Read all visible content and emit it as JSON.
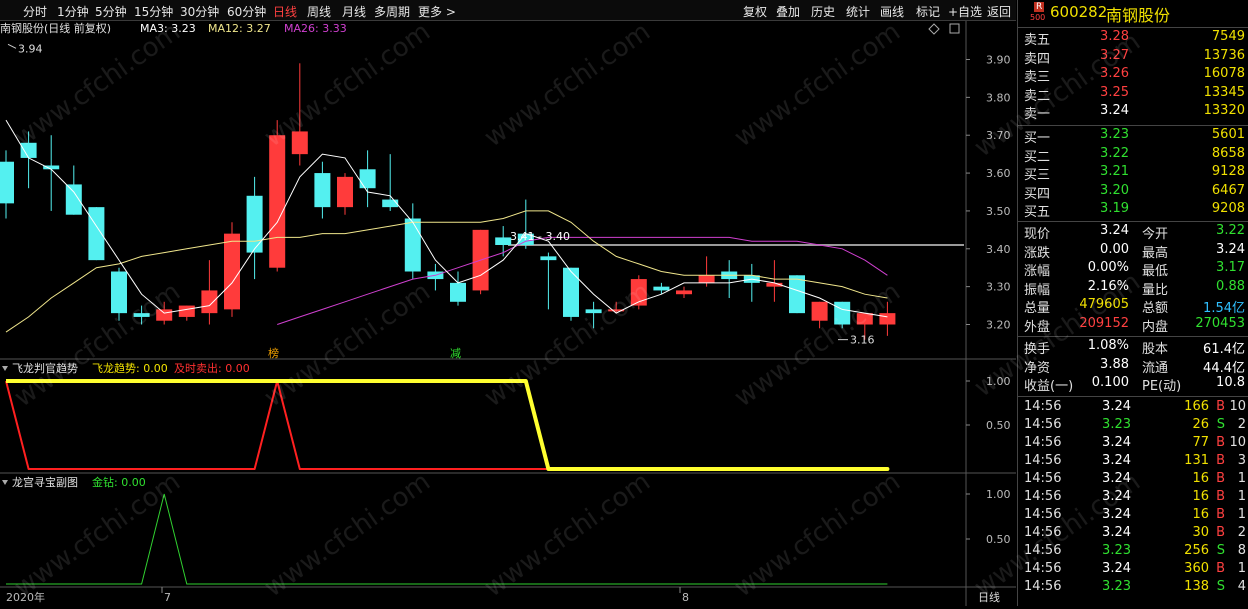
{
  "toolbar": {
    "left_items": [
      "分时",
      "1分钟",
      "5分钟",
      "15分钟",
      "30分钟",
      "60分钟",
      "日线",
      "周线",
      "月线",
      "多周期",
      "更多 >"
    ],
    "active": "日线",
    "right_items": [
      "复权",
      "叠加",
      "历史",
      "统计",
      "画线",
      "标记",
      "+自选",
      "返回"
    ]
  },
  "main_chart": {
    "title": "南钢股份(日线 前复权)",
    "ma3_label": "MA3: 3.23",
    "ma12_label": "MA12: 3.27",
    "ma26_label": "MA26: 3.33",
    "max_label": "3.94",
    "min_label": "3.16",
    "range_label": "3.41 - 3.40",
    "mark_a": "榜",
    "mark_b": "减",
    "y_ticks": [
      "3.90",
      "3.80",
      "3.70",
      "3.60",
      "3.50",
      "3.40",
      "3.30",
      "3.20"
    ],
    "colors": {
      "up": "#ff3b3b",
      "down": "#54f0f0",
      "ma3": "#ffffff",
      "ma12": "#f0e68c",
      "ma26": "#d040d0"
    }
  },
  "chart_data": {
    "type": "candlestick",
    "ylim": [
      3.13,
      3.97
    ],
    "candles": [
      {
        "o": 3.63,
        "h": 3.66,
        "l": 3.48,
        "c": 3.52
      },
      {
        "o": 3.68,
        "h": 3.71,
        "l": 3.56,
        "c": 3.64
      },
      {
        "o": 3.62,
        "h": 3.7,
        "l": 3.5,
        "c": 3.61
      },
      {
        "o": 3.57,
        "h": 3.62,
        "l": 3.49,
        "c": 3.49
      },
      {
        "o": 3.51,
        "h": 3.51,
        "l": 3.37,
        "c": 3.37
      },
      {
        "o": 3.34,
        "h": 3.35,
        "l": 3.21,
        "c": 3.23
      },
      {
        "o": 3.23,
        "h": 3.25,
        "l": 3.2,
        "c": 3.22
      },
      {
        "o": 3.21,
        "h": 3.26,
        "l": 3.2,
        "c": 3.24
      },
      {
        "o": 3.22,
        "h": 3.25,
        "l": 3.21,
        "c": 3.25
      },
      {
        "o": 3.23,
        "h": 3.37,
        "l": 3.2,
        "c": 3.29
      },
      {
        "o": 3.24,
        "h": 3.47,
        "l": 3.22,
        "c": 3.44
      },
      {
        "o": 3.54,
        "h": 3.59,
        "l": 3.32,
        "c": 3.39
      },
      {
        "o": 3.35,
        "h": 3.74,
        "l": 3.34,
        "c": 3.7
      },
      {
        "o": 3.65,
        "h": 3.89,
        "l": 3.62,
        "c": 3.71
      },
      {
        "o": 3.6,
        "h": 3.63,
        "l": 3.48,
        "c": 3.51
      },
      {
        "o": 3.51,
        "h": 3.6,
        "l": 3.49,
        "c": 3.59
      },
      {
        "o": 3.61,
        "h": 3.66,
        "l": 3.51,
        "c": 3.56
      },
      {
        "o": 3.53,
        "h": 3.65,
        "l": 3.5,
        "c": 3.51
      },
      {
        "o": 3.48,
        "h": 3.52,
        "l": 3.32,
        "c": 3.34
      },
      {
        "o": 3.34,
        "h": 3.36,
        "l": 3.29,
        "c": 3.32
      },
      {
        "o": 3.31,
        "h": 3.34,
        "l": 3.25,
        "c": 3.26
      },
      {
        "o": 3.29,
        "h": 3.45,
        "l": 3.28,
        "c": 3.45
      },
      {
        "o": 3.43,
        "h": 3.46,
        "l": 3.38,
        "c": 3.41
      },
      {
        "o": 3.44,
        "h": 3.53,
        "l": 3.4,
        "c": 3.41
      },
      {
        "o": 3.38,
        "h": 3.39,
        "l": 3.24,
        "c": 3.37
      },
      {
        "o": 3.35,
        "h": 3.35,
        "l": 3.21,
        "c": 3.22
      },
      {
        "o": 3.24,
        "h": 3.26,
        "l": 3.19,
        "c": 3.23
      },
      {
        "o": 3.24,
        "h": 3.26,
        "l": 3.23,
        "c": 3.24
      },
      {
        "o": 3.25,
        "h": 3.33,
        "l": 3.24,
        "c": 3.32
      },
      {
        "o": 3.3,
        "h": 3.31,
        "l": 3.28,
        "c": 3.29
      },
      {
        "o": 3.28,
        "h": 3.3,
        "l": 3.27,
        "c": 3.29
      },
      {
        "o": 3.31,
        "h": 3.38,
        "l": 3.3,
        "c": 3.33
      },
      {
        "o": 3.34,
        "h": 3.37,
        "l": 3.27,
        "c": 3.32
      },
      {
        "o": 3.33,
        "h": 3.36,
        "l": 3.26,
        "c": 3.31
      },
      {
        "o": 3.3,
        "h": 3.37,
        "l": 3.26,
        "c": 3.31
      },
      {
        "o": 3.33,
        "h": 3.33,
        "l": 3.23,
        "c": 3.23
      },
      {
        "o": 3.21,
        "h": 3.26,
        "l": 3.19,
        "c": 3.26
      },
      {
        "o": 3.26,
        "h": 3.26,
        "l": 3.19,
        "c": 3.2
      },
      {
        "o": 3.2,
        "h": 3.23,
        "l": 3.16,
        "c": 3.23
      },
      {
        "o": 3.2,
        "h": 3.26,
        "l": 3.17,
        "c": 3.23
      }
    ],
    "ma3": [
      3.74,
      3.64,
      3.61,
      3.55,
      3.46,
      3.37,
      3.28,
      3.23,
      3.24,
      3.25,
      3.31,
      3.4,
      3.47,
      3.59,
      3.65,
      3.64,
      3.55,
      3.54,
      3.47,
      3.37,
      3.31,
      3.33,
      3.37,
      3.44,
      3.42,
      3.34,
      3.28,
      3.23,
      3.26,
      3.28,
      3.31,
      3.31,
      3.31,
      3.32,
      3.31,
      3.29,
      3.27,
      3.24,
      3.23,
      3.22
    ],
    "ma12": [
      3.18,
      3.22,
      3.27,
      3.31,
      3.35,
      3.36,
      3.38,
      3.39,
      3.4,
      3.41,
      3.42,
      3.42,
      3.43,
      3.43,
      3.44,
      3.44,
      3.45,
      3.46,
      3.47,
      3.47,
      3.47,
      3.47,
      3.48,
      3.5,
      3.5,
      3.47,
      3.42,
      3.38,
      3.36,
      3.34,
      3.33,
      3.33,
      3.33,
      3.33,
      3.32,
      3.32,
      3.31,
      3.3,
      3.28,
      3.27
    ],
    "ma26": [
      null,
      null,
      null,
      null,
      null,
      null,
      null,
      null,
      null,
      null,
      null,
      null,
      3.2,
      3.22,
      3.24,
      3.26,
      3.28,
      3.3,
      3.32,
      3.33,
      3.35,
      3.37,
      3.39,
      3.42,
      3.43,
      3.43,
      3.43,
      3.43,
      3.43,
      3.43,
      3.43,
      3.43,
      3.43,
      3.42,
      3.42,
      3.42,
      3.41,
      3.4,
      3.37,
      3.33
    ],
    "hline": 3.41
  },
  "indicator1": {
    "title": "飞龙判官趋势",
    "label_a": "飞龙趋势: 0.00",
    "label_b": "及时卖出: 0.00",
    "y_ticks": [
      "1.00",
      "0.50"
    ],
    "colors": {
      "trend": "#ffff30",
      "sell": "#ff2020"
    },
    "trend": [
      1,
      1,
      1,
      1,
      1,
      1,
      1,
      1,
      1,
      1,
      1,
      1,
      1,
      1,
      1,
      1,
      1,
      1,
      1,
      1,
      1,
      1,
      1,
      1,
      0,
      0,
      0,
      0,
      0,
      0,
      0,
      0,
      0,
      0,
      0,
      0,
      0,
      0,
      0,
      0
    ],
    "sell": [
      1,
      0,
      0,
      0,
      0,
      0,
      0,
      0,
      0,
      0,
      0,
      0,
      1,
      0,
      0,
      0,
      0,
      0,
      0,
      0,
      0,
      0,
      0,
      0,
      0,
      0,
      0,
      0,
      0,
      0,
      0,
      0,
      0,
      0,
      0,
      0,
      0,
      0,
      0,
      0
    ]
  },
  "indicator2": {
    "title": "龙宫寻宝副图",
    "label_a": "金钻: 0.00",
    "y_ticks": [
      "1.00",
      "0.50"
    ],
    "color": "#30d030",
    "values": [
      0,
      0,
      0,
      0,
      0,
      0,
      0,
      1,
      0,
      0,
      0,
      0,
      0,
      0,
      0,
      0,
      0,
      0,
      0,
      0,
      0,
      0,
      0,
      0,
      0,
      0,
      0,
      0,
      0,
      0,
      0,
      0,
      0,
      0,
      0,
      0,
      0,
      0,
      0,
      0
    ]
  },
  "x_axis": {
    "labels": [
      "2020年",
      "7",
      "8"
    ],
    "period": "日线"
  },
  "watermark": "www.cfchi.com",
  "panel": {
    "code": "600282",
    "name": "南钢股份",
    "badge_top": "R",
    "badge_bottom": "500",
    "asks": [
      {
        "label": "卖五",
        "price": "3.28",
        "vol": "7549"
      },
      {
        "label": "卖四",
        "price": "3.27",
        "vol": "13736"
      },
      {
        "label": "卖三",
        "price": "3.26",
        "vol": "16078"
      },
      {
        "label": "卖二",
        "price": "3.25",
        "vol": "13345"
      },
      {
        "label": "卖一",
        "price": "3.24",
        "vol": "13320"
      }
    ],
    "bids": [
      {
        "label": "买一",
        "price": "3.23",
        "vol": "5601"
      },
      {
        "label": "买二",
        "price": "3.22",
        "vol": "8658"
      },
      {
        "label": "买三",
        "price": "3.21",
        "vol": "9128"
      },
      {
        "label": "买四",
        "price": "3.20",
        "vol": "6467"
      },
      {
        "label": "买五",
        "price": "3.19",
        "vol": "9208"
      }
    ],
    "stats": [
      {
        "k1": "现价",
        "v1": "3.24",
        "c1": "#ffffff",
        "k2": "今开",
        "v2": "3.22",
        "c2": "#30e030"
      },
      {
        "k1": "涨跌",
        "v1": "0.00",
        "c1": "#ffffff",
        "k2": "最高",
        "v2": "3.24",
        "c2": "#ffffff"
      },
      {
        "k1": "涨幅",
        "v1": "0.00%",
        "c1": "#ffffff",
        "k2": "最低",
        "v2": "3.17",
        "c2": "#30e030"
      },
      {
        "k1": "振幅",
        "v1": "2.16%",
        "c1": "#ffffff",
        "k2": "量比",
        "v2": "0.88",
        "c2": "#30e030"
      },
      {
        "k1": "总量",
        "v1": "479605",
        "c1": "#f0e000",
        "k2": "总额",
        "v2": "1.54亿",
        "c2": "#30c0ff"
      },
      {
        "k1": "外盘",
        "v1": "209152",
        "c1": "#ff4040",
        "k2": "内盘",
        "v2": "270453",
        "c2": "#30e030"
      }
    ],
    "stats2": [
      {
        "k1": "换手",
        "v1": "1.08%",
        "k2": "股本",
        "v2": "61.4亿"
      },
      {
        "k1": "净资",
        "v1": "3.88",
        "k2": "流通",
        "v2": "44.4亿"
      },
      {
        "k1": "收益(一)",
        "v1": "0.100",
        "k2": "PE(动)",
        "v2": "10.8"
      }
    ],
    "ticks": [
      {
        "t": "14:56",
        "p": "3.24",
        "pc": "#ffffff",
        "v": "166",
        "vc": "#f0e000",
        "s": "B",
        "n": "10"
      },
      {
        "t": "14:56",
        "p": "3.23",
        "pc": "#30e030",
        "v": "26",
        "vc": "#f0e000",
        "s": "S",
        "n": "2"
      },
      {
        "t": "14:56",
        "p": "3.24",
        "pc": "#ffffff",
        "v": "77",
        "vc": "#f0e000",
        "s": "B",
        "n": "10"
      },
      {
        "t": "14:56",
        "p": "3.24",
        "pc": "#ffffff",
        "v": "131",
        "vc": "#f0e000",
        "s": "B",
        "n": "3"
      },
      {
        "t": "14:56",
        "p": "3.24",
        "pc": "#ffffff",
        "v": "16",
        "vc": "#f0e000",
        "s": "B",
        "n": "1"
      },
      {
        "t": "14:56",
        "p": "3.24",
        "pc": "#ffffff",
        "v": "16",
        "vc": "#f0e000",
        "s": "B",
        "n": "1"
      },
      {
        "t": "14:56",
        "p": "3.24",
        "pc": "#ffffff",
        "v": "16",
        "vc": "#f0e000",
        "s": "B",
        "n": "1"
      },
      {
        "t": "14:56",
        "p": "3.24",
        "pc": "#ffffff",
        "v": "30",
        "vc": "#f0e000",
        "s": "B",
        "n": "2"
      },
      {
        "t": "14:56",
        "p": "3.23",
        "pc": "#30e030",
        "v": "256",
        "vc": "#f0e000",
        "s": "S",
        "n": "8"
      },
      {
        "t": "14:56",
        "p": "3.24",
        "pc": "#ffffff",
        "v": "360",
        "vc": "#f0e000",
        "s": "B",
        "n": "1"
      },
      {
        "t": "14:56",
        "p": "3.23",
        "pc": "#30e030",
        "v": "138",
        "vc": "#f0e000",
        "s": "S",
        "n": "4"
      }
    ]
  }
}
